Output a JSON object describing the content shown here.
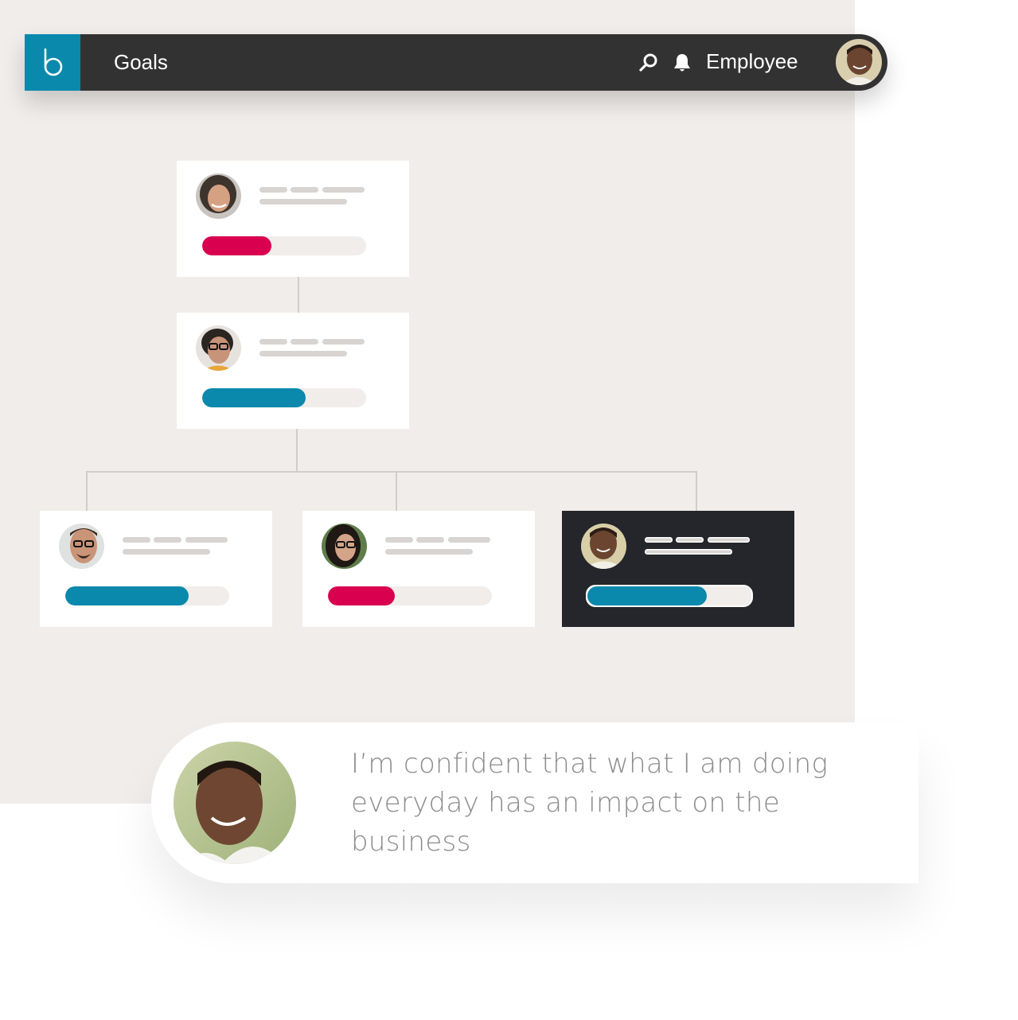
{
  "header": {
    "logo_letter": "b",
    "title": "Goals",
    "user_label": "Employee",
    "icons": [
      "search-icon",
      "bell-icon"
    ]
  },
  "colors": {
    "brand": "#0a89ad",
    "header_bg": "#333232",
    "alert": "#d8004f",
    "progress_blue": "#0a89ad",
    "panel_bg": "#f1edea",
    "highlight_card": "#25262b"
  },
  "org_chart": {
    "cards": [
      {
        "id": "ceo",
        "level": 0,
        "progress": 0.42,
        "status_color": "#d8004f",
        "highlighted": false,
        "avatar": "woman-curly-hair"
      },
      {
        "id": "manager",
        "level": 1,
        "progress": 0.63,
        "status_color": "#0a89ad",
        "highlighted": false,
        "avatar": "woman-glasses"
      },
      {
        "id": "report-1",
        "level": 2,
        "progress": 0.75,
        "status_color": "#0a89ad",
        "highlighted": false,
        "avatar": "man-glasses"
      },
      {
        "id": "report-2",
        "level": 2,
        "progress": 0.41,
        "status_color": "#d8004f",
        "highlighted": false,
        "avatar": "woman-glasses-dark-hair"
      },
      {
        "id": "report-3",
        "level": 2,
        "progress": 0.73,
        "status_color": "#0a89ad",
        "highlighted": true,
        "avatar": "man-smiling"
      }
    ]
  },
  "quote": {
    "text": "I’m confident that what I am doing everyday has an impact on the business",
    "avatar": "man-smiling"
  }
}
